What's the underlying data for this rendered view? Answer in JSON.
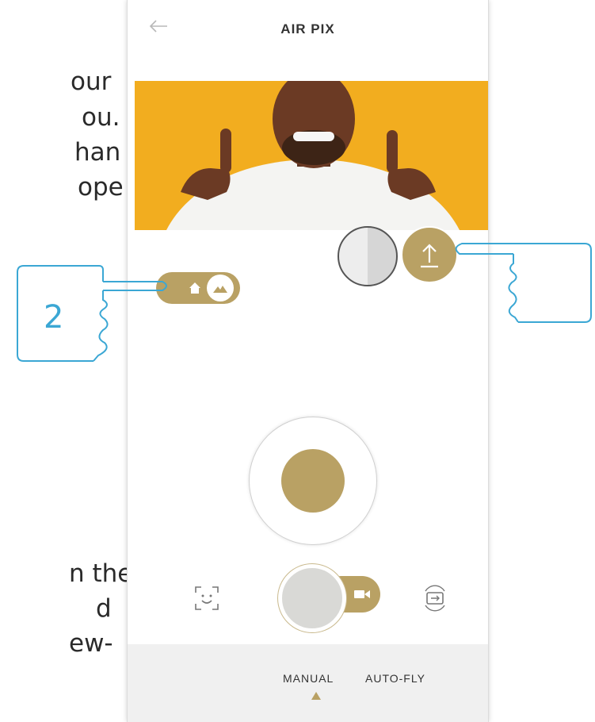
{
  "side_text_lines": [
    "our",
    "ou.",
    "han",
    "ope",
    "n the",
    "d",
    "ew-"
  ],
  "header": {
    "title": "AIR PIX",
    "back_icon": "arrow-left-icon"
  },
  "controls": {
    "contrast_icon": "half-circle-icon",
    "upload_icon": "upload-icon",
    "home_icon": "home-icon",
    "landscape_icon": "mountain-icon",
    "face_icon": "face-frame-icon",
    "video_icon": "video-camera-icon",
    "rotate_icon": "camera-switch-icon"
  },
  "callouts": {
    "left_number": "2"
  },
  "tabs": [
    {
      "label": "MANUAL",
      "active": true
    },
    {
      "label": "AUTO-FLY",
      "active": false
    }
  ],
  "colors": {
    "accent": "#b9a164",
    "callout": "#3ba7d4",
    "photo_bg": "#f2ad1f"
  }
}
